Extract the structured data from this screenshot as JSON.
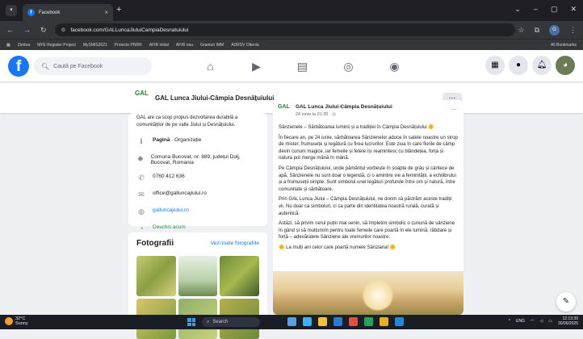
{
  "browser": {
    "tab_title": "Facebook",
    "tab_close": "×",
    "new_tab": "+",
    "url": "facebook.com/GALLuncaJiuluiCampiaDesnatuiului",
    "bookmarks": [
      "Zimbra",
      "MFE Register Project",
      "MySMIS2021",
      "Proiecte PNRR",
      "AFIR initial",
      "AFIR nou",
      "Granturi IMM",
      "ADRSV Oltenia"
    ],
    "all_bookmarks": "All Bookmarks"
  },
  "facebook": {
    "logo": "f",
    "search_placeholder": "Caută pe Facebook"
  },
  "page": {
    "name": "GAL Lunca Jiului-Câmpia Desnățuiului",
    "logo_text": "GAL",
    "more": "···"
  },
  "intro": {
    "description": "GAL are ca scop propus dezvoltarea durabilă a comunităților de pe valle Jiului și Desnățuiului.",
    "category_label": "Pagină",
    "category_value": " · Organizație",
    "address": "Comuna Bucovat, nr. 889, județul Dolj, Bucovat, Romania",
    "phone": "0760 412 636",
    "email": "office@galluncajiului.ro",
    "website": "galluncajiului.ro",
    "status": "Deschis acum"
  },
  "photos": {
    "title": "Fotografii",
    "see_all": "Vezi toate fotografiile"
  },
  "post": {
    "author": "GAL Lunca Jiului-Câmpia Desnățuiului",
    "date": "24 iunie la 01:35 · ◎",
    "dots": "···",
    "paragraphs": [
      "Sânzienele – Sărbătoarea luminii și a tradiției în Câmpia Desnățuiului 🌼",
      "În fiecare an, pe 24 iunie, sărbătoarea Sânzienelor aduce în satele noastre un strop de mister, frumusețe și legătură cu firea lucrurilor. Este ziua în care florile de câmp devin cununi magice, iar femeile și fetele își reamintesc cu blândețea, forța și natura pot merge mână în mână.",
      "Pe Câmpia Desnățuiului, unde pământul vorbește în șoapte de grâu și cântece de apă, Sânzienele nu sunt doar o legendă, ci o amintire vie a feminității, a echilibrului și a frumuseții simple. Sunt simbolul unei legături profunde între om și natură, între comunitate și sărbătoare.",
      "Prin GAL Lunca Jiului – Câmpia Desnățuiului, ne dorim să păstrăm aceste tradiții vii. Nu doar ca simboluri, ci ca parte din identitatea noastră rurală, curată și autentică.",
      "Astăzi, să privim cerul puțin mai senin, să împletim simbolic o cunună de sânziene în gând și să mulțumim pentru toate femeile care poartă în ele lumină, răbdare și forță – adevăratele Sânziene ale vremurilor noastre.",
      "🌼 La mulți ani celor care poartă numele Sânziana! 🌼"
    ]
  },
  "taskbar": {
    "temp": "32°C",
    "weather": "Sunny",
    "search": "Search",
    "lang": "ENG",
    "time": "12:13:39",
    "date": "30/06/2025"
  },
  "icons": [
    "home-icon",
    "video-icon",
    "marketplace-icon",
    "groups-icon",
    "gaming-icon",
    "menu-grid-icon",
    "messenger-icon",
    "bell-icon"
  ]
}
